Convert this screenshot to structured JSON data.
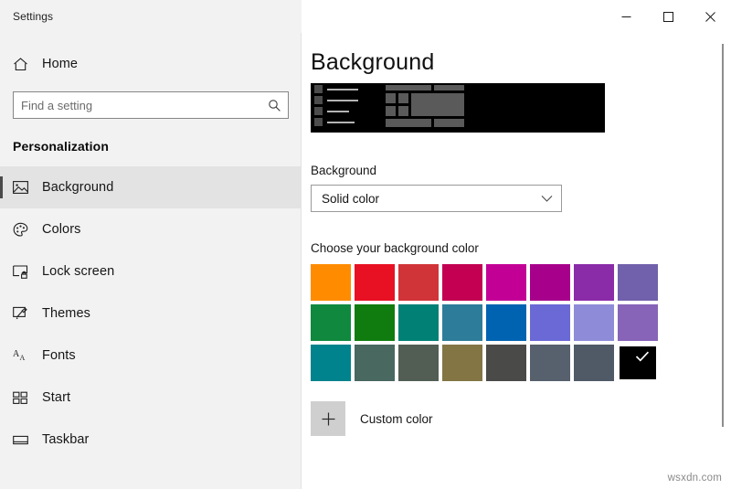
{
  "window": {
    "app_title": "Settings",
    "controls": {
      "minimize": "minimize-button",
      "maximize": "maximize-button",
      "close": "close-button"
    }
  },
  "sidebar": {
    "home": {
      "label": "Home",
      "icon": "home-icon"
    },
    "search": {
      "placeholder": "Find a setting",
      "value": "",
      "icon": "search-icon"
    },
    "section_title": "Personalization",
    "items": [
      {
        "label": "Background",
        "icon": "image-icon",
        "selected": true
      },
      {
        "label": "Colors",
        "icon": "palette-icon",
        "selected": false
      },
      {
        "label": "Lock screen",
        "icon": "lock-screen-icon",
        "selected": false
      },
      {
        "label": "Themes",
        "icon": "themes-icon",
        "selected": false
      },
      {
        "label": "Fonts",
        "icon": "fonts-icon",
        "selected": false
      },
      {
        "label": "Start",
        "icon": "start-icon",
        "selected": false
      },
      {
        "label": "Taskbar",
        "icon": "taskbar-icon",
        "selected": false
      }
    ]
  },
  "main": {
    "page_title": "Background",
    "preview": {
      "background_color": "#000000",
      "rail_icon_color": "#4c4c4c",
      "rail_line_color": "#b4b4b4",
      "tile_color": "#5a5a5a"
    },
    "background_section": {
      "label": "Background",
      "dropdown_value": "Solid color",
      "dropdown_icon": "chevron-down-icon"
    },
    "color_section": {
      "heading": "Choose your background color",
      "swatches": [
        {
          "name": "orange",
          "hex": "#FF8C00",
          "selected": false
        },
        {
          "name": "red",
          "hex": "#E81123",
          "selected": false
        },
        {
          "name": "salmon-red",
          "hex": "#D13438",
          "selected": false
        },
        {
          "name": "crimson",
          "hex": "#C30052",
          "selected": false
        },
        {
          "name": "magenta",
          "hex": "#C30095",
          "selected": false
        },
        {
          "name": "dark-magenta",
          "hex": "#A7018C",
          "selected": false
        },
        {
          "name": "purple",
          "hex": "#8A2BA8",
          "selected": false
        },
        {
          "name": "violet",
          "hex": "#7160AB",
          "selected": false
        },
        {
          "name": "green",
          "hex": "#10893E",
          "selected": false
        },
        {
          "name": "dark-green",
          "hex": "#107C10",
          "selected": false
        },
        {
          "name": "teal",
          "hex": "#018075",
          "selected": false
        },
        {
          "name": "steel-blue",
          "hex": "#2D7D9A",
          "selected": false
        },
        {
          "name": "blue",
          "hex": "#0063B1",
          "selected": false
        },
        {
          "name": "periwinkle",
          "hex": "#6B69D6",
          "selected": false
        },
        {
          "name": "light-periwinkle",
          "hex": "#8E8CD8",
          "selected": false
        },
        {
          "name": "light-purple",
          "hex": "#8764B8",
          "selected": false
        },
        {
          "name": "dark-teal",
          "hex": "#00838C",
          "selected": false
        },
        {
          "name": "sage",
          "hex": "#486860",
          "selected": false
        },
        {
          "name": "gray-green",
          "hex": "#525E54",
          "selected": false
        },
        {
          "name": "khaki",
          "hex": "#847545",
          "selected": false
        },
        {
          "name": "dark-gray",
          "hex": "#4A4A48",
          "selected": false
        },
        {
          "name": "slate-gray",
          "hex": "#57606D",
          "selected": false
        },
        {
          "name": "blue-gray",
          "hex": "#4F5A66",
          "selected": false
        },
        {
          "name": "black",
          "hex": "#000000",
          "selected": true
        }
      ],
      "custom": {
        "label": "Custom color",
        "icon": "plus-icon"
      }
    }
  },
  "watermark": "wsxdn.com"
}
